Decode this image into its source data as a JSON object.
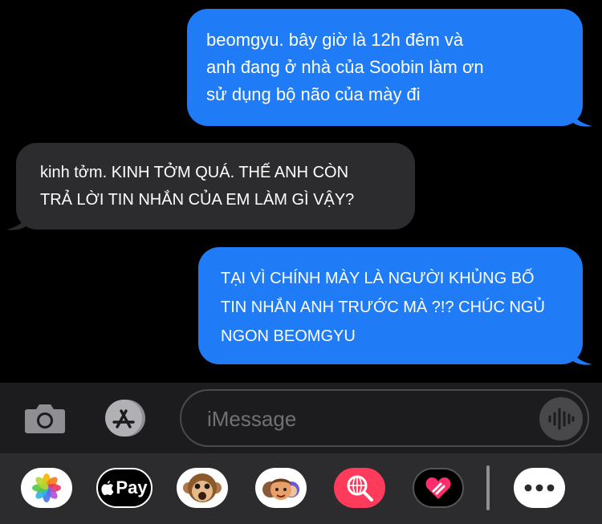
{
  "messages": [
    {
      "direction": "outgoing",
      "text": "beomgyu. bây giờ là 12h đêm và\nanh đang ở nhà của Soobin làm ơn\nsử dụng bộ não của mày đi"
    },
    {
      "direction": "incoming",
      "text": "kinh tởm.  KINH TỞM QUÁ.  THẾ ANH CÒN\nTRẢ LỜI TIN NHẮN CỦA EM LÀM GÌ VẬY?"
    },
    {
      "direction": "outgoing",
      "text": "TẠI VÌ CHÍNH MÀY LÀ NGƯỜI KHỦNG BỐ\nTIN NHẮN ANH TRƯỚC MÀ ?!? CHÚC NGỦ\nNGON BEOMGYU"
    }
  ],
  "input": {
    "placeholder": "iMessage"
  },
  "apps": {
    "applepay_label": "Pay",
    "items": [
      "photos-icon",
      "apple-pay-icon",
      "animoji-icon",
      "memoji-icon",
      "image-search-icon",
      "digital-touch-icon",
      "more-icon"
    ]
  },
  "colors": {
    "outgoing": "#1f7cf6",
    "incoming": "#2c2c2e",
    "background": "#000000"
  }
}
